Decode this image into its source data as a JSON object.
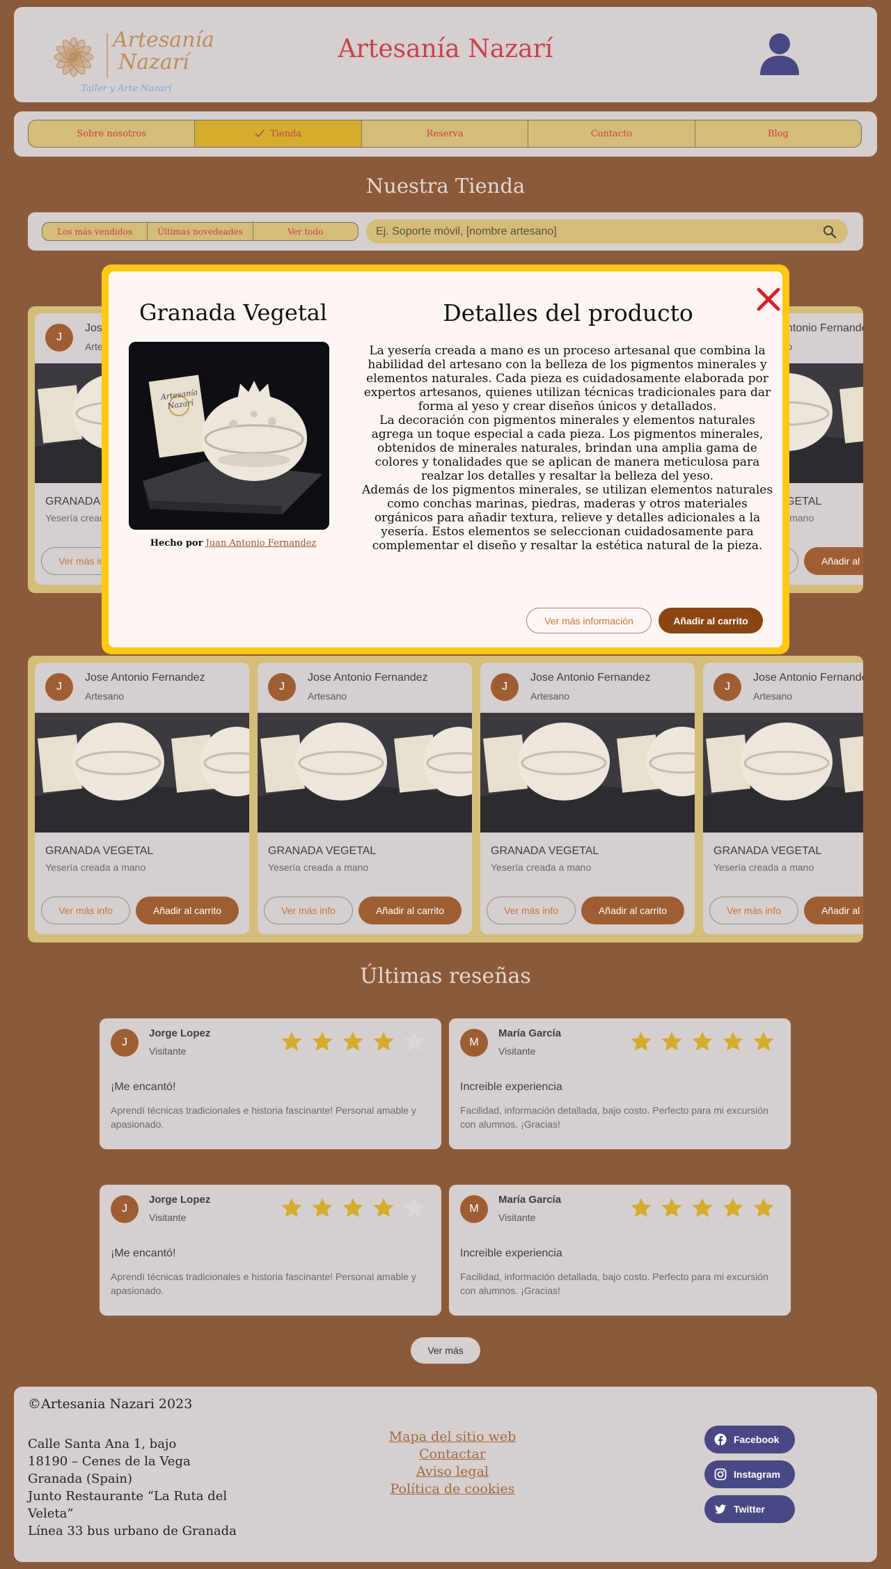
{
  "header": {
    "logo_name_line1": "Artesanía",
    "logo_name_line2": "Nazarí",
    "logo_tagline": "Taller y Arte Nazarí",
    "site_title": "Artesanía Nazarí"
  },
  "nav": {
    "items": [
      {
        "label": "Sobre nosotros"
      },
      {
        "label": "Tienda",
        "active": true
      },
      {
        "label": "Reserva"
      },
      {
        "label": "Contacto"
      },
      {
        "label": "Blog"
      }
    ]
  },
  "store": {
    "title": "Nuestra Tienda",
    "filters": [
      "Los más vendidos",
      "Últimas novedeades",
      "Ver todo"
    ],
    "search_placeholder": "Ej. Soporte móvil, [nombre artesano]"
  },
  "product_card": {
    "avatar_initial": "J",
    "artist": "Jose Antonio Fernandez",
    "role": "Artesano",
    "name": "GRANADA VEGETAL",
    "description": "Yesería creada a mano",
    "info_button": "Ver más info",
    "cart_button": "Añadir al carrito"
  },
  "modal": {
    "product_title": "Granada Vegetal",
    "details_title": "Detalles del producto",
    "credit_prefix": "Hecho por",
    "credit_artist": "Juan Antonio Fernandez",
    "description": [
      "La yesería creada a mano es un proceso artesanal que combina la habilidad del artesano con la belleza de los pigmentos minerales y elementos naturales. Cada pieza es cuidadosamente elaborada por expertos artesanos, quienes utilizan técnicas tradicionales para dar forma al yeso y crear diseños únicos y detallados.",
      "La decoración con pigmentos minerales y elementos naturales agrega un toque especial a cada pieza. Los pigmentos minerales, obtenidos de minerales naturales, brindan una amplia gama de colores y tonalidades que se aplican de manera meticulosa para realzar los detalles y resaltar la belleza del yeso.",
      "Además de los pigmentos minerales, se utilizan elementos naturales como conchas marinas, piedras, maderas y otros materiales orgánicos para añadir textura, relieve y detalles adicionales a la yesería. Estos elementos se seleccionan cuidadosamente para complementar el diseño y resaltar la estética natural de la pieza."
    ],
    "info_button": "Ver más información",
    "cart_button": "Añadir al carrito",
    "package_label_line1": "Artesanía",
    "package_label_line2": "Nazarí"
  },
  "reviews": {
    "title": "Últimas reseñas",
    "items": [
      {
        "initial": "J",
        "name": "Jorge Lopez",
        "role": "Visitante",
        "rating": 4,
        "headline": "¡Me encantó!",
        "text": "Aprendí técnicas tradicionales e historia fascinante! Personal amable y apasionado."
      },
      {
        "initial": "M",
        "name": "María García",
        "role": "Visitante",
        "rating": 5,
        "headline": "Increible experiencia",
        "text": "Facilidad, información detallada, bajo costo. Perfecto para mi excursión con alumnos. ¡Gracias!"
      },
      {
        "initial": "J",
        "name": "Jorge Lopez",
        "role": "Visitante",
        "rating": 4,
        "headline": "¡Me encantó!",
        "text": "Aprendí técnicas tradicionales e historia fascinante! Personal amable y apasionado."
      },
      {
        "initial": "M",
        "name": "María García",
        "role": "Visitante",
        "rating": 5,
        "headline": "Increible experiencia",
        "text": "Facilidad, información detallada, bajo costo. Perfecto para mi excursión con alumnos. ¡Gracias!"
      }
    ],
    "more_button": "Ver más"
  },
  "footer": {
    "copyright": "©Artesania Nazari 2023",
    "address": [
      "Calle Santa Ana 1, bajo",
      "18190 – Cenes de la Vega",
      "Granada (Spain)",
      "Junto Restaurante “La Ruta del",
      "Veleta”",
      "Línea 33 bus urbano de Granada"
    ],
    "links": [
      "Mapa del sitio web",
      "Contactar",
      "Aviso legal",
      "Política de cookies"
    ],
    "social": [
      {
        "label": "Facebook",
        "icon": "facebook-icon"
      },
      {
        "label": "Instagram",
        "icon": "instagram-icon"
      },
      {
        "label": "Twitter",
        "icon": "twitter-icon"
      }
    ]
  },
  "colors": {
    "background": "#8b5a3b",
    "panel": "#d6cfcf",
    "accent_red": "#c9414a",
    "gold": "#d4bd79",
    "active_gold": "#d4ac2e",
    "brown_button": "#9e5e33",
    "modal_border": "#ffc813",
    "social": "#4a4785",
    "star": "#d4ac2e"
  }
}
